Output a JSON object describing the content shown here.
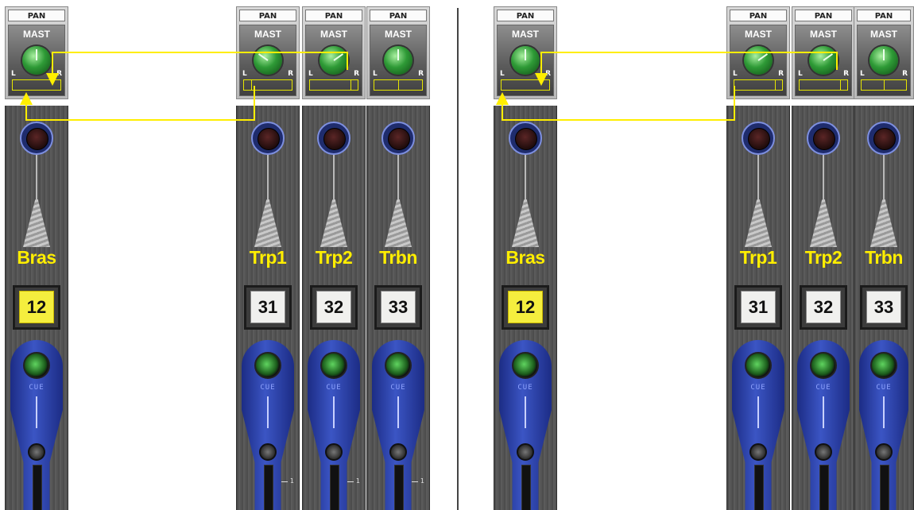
{
  "panels": [
    {
      "channels": [
        {
          "pan_label": "PAN",
          "mast_label": "MAST",
          "l": "L",
          "r": "R",
          "name": "Bras",
          "number": "12",
          "selected": true,
          "cue": "CUE",
          "scale": "1"
        },
        {
          "pan_label": "PAN",
          "mast_label": "MAST",
          "l": "L",
          "r": "R",
          "name": "Trp1",
          "number": "31",
          "selected": false,
          "cue": "CUE",
          "scale": "1"
        },
        {
          "pan_label": "PAN",
          "mast_label": "MAST",
          "l": "L",
          "r": "R",
          "name": "Trp2",
          "number": "32",
          "selected": false,
          "cue": "CUE",
          "scale": "1"
        },
        {
          "pan_label": "PAN",
          "mast_label": "MAST",
          "l": "L",
          "r": "R",
          "name": "Trbn",
          "number": "33",
          "selected": false,
          "cue": "CUE",
          "scale": "1"
        }
      ]
    },
    {
      "channels": [
        {
          "pan_label": "PAN",
          "mast_label": "MAST",
          "l": "L",
          "r": "R",
          "name": "Bras",
          "number": "12",
          "selected": true,
          "cue": "CUE",
          "scale": "1"
        },
        {
          "pan_label": "PAN",
          "mast_label": "MAST",
          "l": "L",
          "r": "R",
          "name": "Trp1",
          "number": "31",
          "selected": false,
          "cue": "CUE",
          "scale": "1"
        },
        {
          "pan_label": "PAN",
          "mast_label": "MAST",
          "l": "L",
          "r": "R",
          "name": "Trp2",
          "number": "32",
          "selected": false,
          "cue": "CUE",
          "scale": "1"
        },
        {
          "pan_label": "PAN",
          "mast_label": "MAST",
          "l": "L",
          "r": "R",
          "name": "Trbn",
          "number": "33",
          "selected": false,
          "cue": "CUE",
          "scale": "1"
        }
      ]
    }
  ],
  "colors": {
    "label_yellow": "#ffee00",
    "wire": "#e6e600",
    "cue_blue": "#2f47b8"
  }
}
